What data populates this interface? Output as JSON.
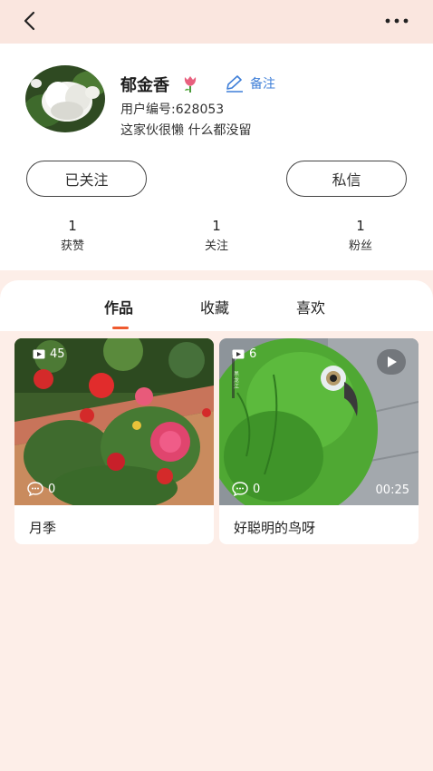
{
  "profile": {
    "name": "郁金香",
    "remark_label": "备注",
    "user_id": "用户编号:628053",
    "bio": "这家伙很懒 什么都没留",
    "follow_button": "已关注",
    "message_button": "私信",
    "stats": [
      {
        "value": "1",
        "label": "获赞"
      },
      {
        "value": "1",
        "label": "关注"
      },
      {
        "value": "1",
        "label": "粉丝"
      }
    ]
  },
  "tabs": [
    {
      "label": "作品",
      "active": true
    },
    {
      "label": "收藏",
      "active": false
    },
    {
      "label": "喜欢",
      "active": false
    }
  ],
  "posts": [
    {
      "title": "月季",
      "views": "45",
      "comments": "0"
    },
    {
      "title": "好聪明的鸟呀",
      "views": "6",
      "comments": "0",
      "duration": "00:25",
      "watermark": "黑龙江"
    }
  ],
  "colors": {
    "accent": "#ef5a2f",
    "remark_blue": "#3f7fd8",
    "page_bg": "#fdeee8"
  }
}
